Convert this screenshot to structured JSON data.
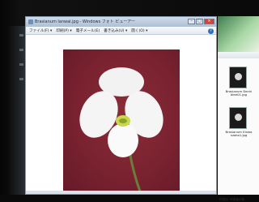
{
  "window": {
    "title": "Brasianum lanwai.jpg - Windows フォト ビューアー",
    "controls": [
      "–",
      "□",
      "×"
    ]
  },
  "menubar": {
    "items": [
      "ファイル(F) ▾",
      "印刷(P) ▾",
      "電子メール(E)",
      "書き込み(U) ▾",
      "開く(O) ▾"
    ],
    "help": "?"
  },
  "viewer": {
    "image_subject": "white slipper orchid on dark red background"
  },
  "side_panel": {
    "files": [
      {
        "caption": "Brasianum Dechiblee01.jpg"
      },
      {
        "caption": "Brasianum Kinwa nzaka1.jpg"
      }
    ],
    "footer": "作成日: 作成者の数..."
  },
  "colors": {
    "photo_bg": "#7a2230",
    "titlebar": "#aebfd3",
    "help_icon": "#2f6fc2"
  }
}
